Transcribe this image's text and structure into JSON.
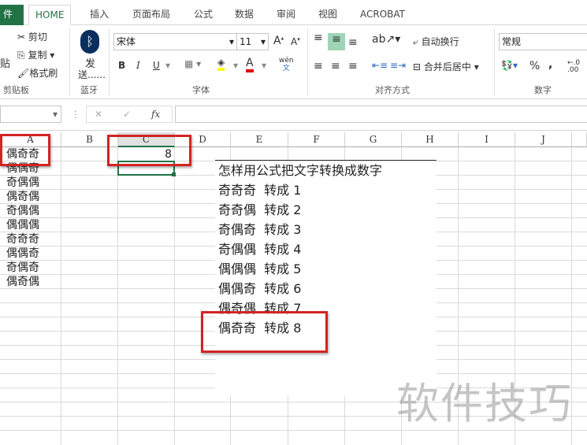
{
  "tabs": [
    "件",
    "HOME",
    "插入",
    "页面布局",
    "公式",
    "数据",
    "审阅",
    "视图",
    "ACROBAT"
  ],
  "ribbon": {
    "paste": "贴",
    "cut": "剪切",
    "copy": "复制",
    "format_painter": "格式刷",
    "clipboard": "剪贴板",
    "send": "发",
    "send2": "送......",
    "bluetooth": "蓝牙",
    "font_name": "宋体",
    "font_size": "11",
    "bold": "B",
    "italic": "I",
    "underline": "U",
    "font_group": "字体",
    "wen": "wén",
    "wrap": "自动换行",
    "merge": "合并后居中",
    "align_group": "对齐方式",
    "number_format": "常规",
    "percent": "%",
    "comma": ",",
    "number_group": "数字"
  },
  "formula": {
    "fx": "fx",
    "cancel": "✕",
    "enter": "✓",
    "value": ""
  },
  "columns": [
    "A",
    "B",
    "C",
    "D",
    "E",
    "F",
    "G",
    "H",
    "I",
    "J"
  ],
  "col_a": [
    "偶奇奇",
    "偶偶奇",
    "奇偶偶",
    "偶奇偶",
    "奇偶偶",
    "偶偶偶",
    "奇奇奇",
    "偶偶奇",
    "奇偶奇",
    "偶奇偶"
  ],
  "c1": "8",
  "note": [
    "怎样用公式把文字转换成数字",
    "奇奇奇  转成 1",
    "奇奇偶  转成 2",
    "奇偶奇  转成 3",
    "奇偶偶  转成 4",
    "偶偶偶  转成 5",
    "偶偶奇  转成 6",
    "偶奇偶  转成 7",
    "偶奇奇  转成 8"
  ],
  "watermark": "软件技巧",
  "colors": {
    "accent": "#217346",
    "highlight": "#d42323"
  }
}
